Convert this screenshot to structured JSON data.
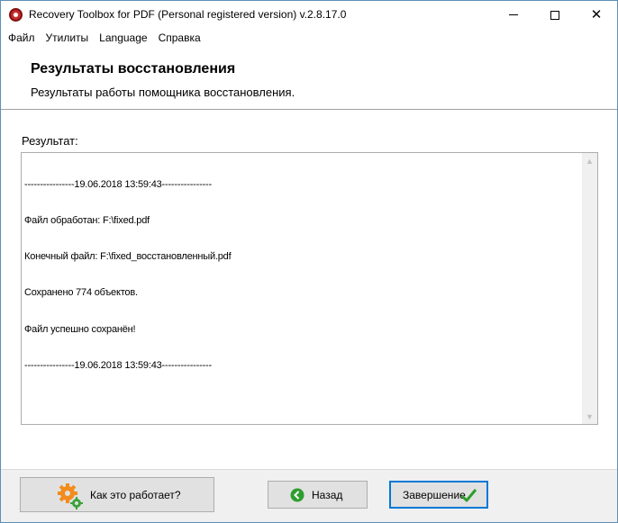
{
  "window": {
    "title": "Recovery Toolbox for PDF (Personal registered version) v.2.8.17.0",
    "close_glyph": "✕"
  },
  "menu": {
    "items": [
      {
        "label": "Файл"
      },
      {
        "label": "Утилиты"
      },
      {
        "label": "Language"
      },
      {
        "label": "Справка"
      }
    ]
  },
  "header": {
    "title": "Результаты восстановления",
    "subtitle": "Результаты работы помощника восстановления."
  },
  "result": {
    "label": "Результат:",
    "lines": [
      "----------------19.06.2018 13:59:43----------------",
      "Файл обработан: F:\\fixed.pdf",
      "Конечный файл: F:\\fixed_восстановленный.pdf",
      "Сохранено 774 объектов.",
      "Файл успешно сохранён!",
      "----------------19.06.2018 13:59:43----------------"
    ]
  },
  "footer": {
    "help_label": "Как это работает?",
    "back_label": "Назад",
    "finish_label": "Завершение"
  },
  "colors": {
    "accent": "#0078d7",
    "back_icon": "#2e9d2e",
    "check_icon": "#2e9d2e",
    "gear_orange": "#f28c1d",
    "gear_green": "#3aa33a"
  }
}
